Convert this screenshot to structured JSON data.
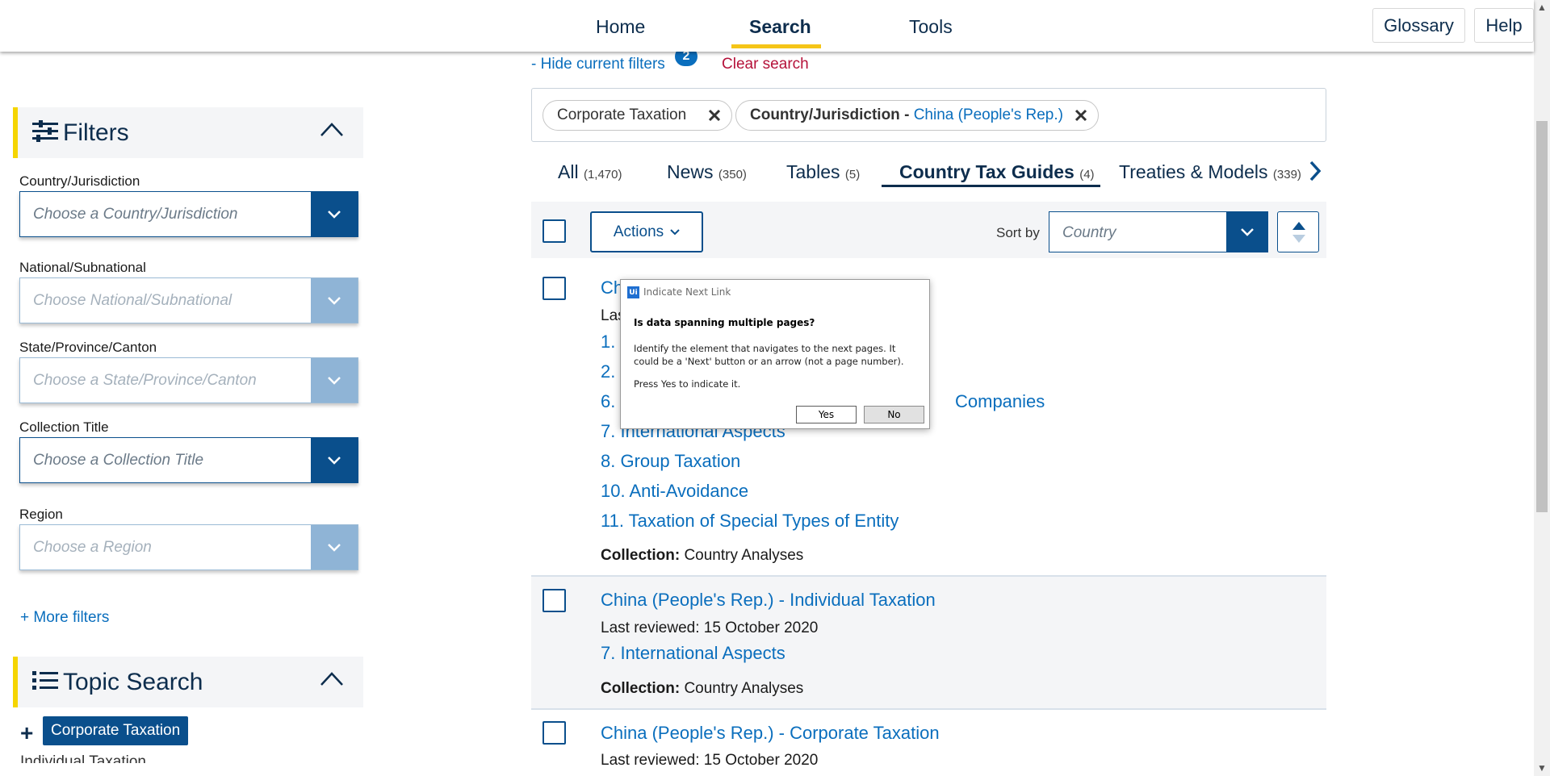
{
  "nav": {
    "items": [
      "Home",
      "Search",
      "Tools"
    ],
    "active": "Search",
    "glossary": "Glossary",
    "help": "Help"
  },
  "sidebar": {
    "filters_title": "Filters",
    "fields": [
      {
        "label": "Country/Jurisdiction",
        "placeholder": "Choose a Country/Jurisdiction",
        "enabled": true
      },
      {
        "label": "National/Subnational",
        "placeholder": "Choose National/Subnational",
        "enabled": false
      },
      {
        "label": "State/Province/Canton",
        "placeholder": "Choose a State/Province/Canton",
        "enabled": false
      },
      {
        "label": "Collection Title",
        "placeholder": "Choose a Collection Title",
        "enabled": true
      },
      {
        "label": "Region",
        "placeholder": "Choose a Region",
        "enabled": false
      }
    ],
    "more_filters": "+ More filters",
    "topic_title": "Topic Search",
    "topic_tag": "Corporate Taxation",
    "topic_peek": "Individual Taxation"
  },
  "filters_bar": {
    "hide_label": "- Hide current filters",
    "badge": "2",
    "clear_label": "Clear search",
    "chips": [
      {
        "text": "Corporate Taxation"
      },
      {
        "prefix": "Country/Jurisdiction - ",
        "value": "China (People's Rep.)"
      }
    ]
  },
  "tabs": [
    {
      "label": "All",
      "count": "(1,470)"
    },
    {
      "label": "News",
      "count": "(350)"
    },
    {
      "label": "Tables",
      "count": "(5)"
    },
    {
      "label": "Country Tax Guides",
      "count": "(4)",
      "active": true
    },
    {
      "label": "Treaties & Models",
      "count": "(339)"
    }
  ],
  "toolbar": {
    "actions_label": "Actions",
    "sort_by_label": "Sort by",
    "sort_placeholder": "Country"
  },
  "results": [
    {
      "title": "Ch",
      "meta": "Las",
      "links": [
        "1.",
        "2.",
        "6.",
        "7. International Aspects",
        "8. Group Taxation",
        "10. Anti-Avoidance",
        "11. Taxation of Special Types of Entity"
      ],
      "link_tail": "Companies",
      "collection_label": "Collection:",
      "collection_value": "Country Analyses"
    },
    {
      "title": "China (People's Rep.) - Individual Taxation",
      "meta": "Last reviewed: 15 October 2020",
      "links": [
        "7. International Aspects"
      ],
      "collection_label": "Collection:",
      "collection_value": "Country Analyses"
    },
    {
      "title": "China (People's Rep.) - Corporate Taxation",
      "meta": "Last reviewed: 15 October 2020"
    }
  ],
  "dialog": {
    "title": "Indicate Next Link",
    "icon_text": "Ui",
    "question": "Is data spanning multiple pages?",
    "body": "Identify the element that navigates to the next pages. It could be a 'Next' button or an arrow (not a page number).",
    "press": "Press Yes to indicate it.",
    "yes": "Yes",
    "no": "No"
  },
  "colors": {
    "brand_blue": "#0a4f8c",
    "link_blue": "#0a6ebd",
    "accent_yellow": "#f5c518",
    "clear_red": "#b5123a"
  }
}
